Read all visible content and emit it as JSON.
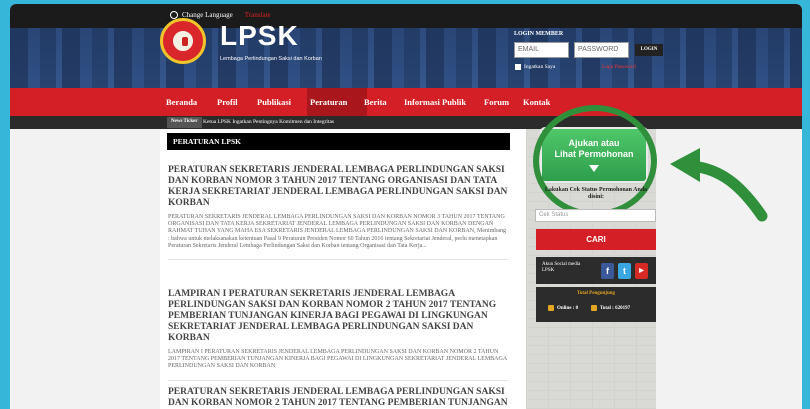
{
  "topbar": {
    "change_language": "Change Language",
    "translate": "Translate"
  },
  "header": {
    "logo_title": "LPSK",
    "logo_subtitle": "Lembaga Perlindungan Saksi dan Korban"
  },
  "login": {
    "label": "LOGIN MEMBER",
    "email_placeholder": "EMAIL",
    "password_placeholder": "PASSWORD",
    "button": "LOGIN",
    "remember": "Ingatkan Saya",
    "forgot": "Lupa Password"
  },
  "nav": {
    "items": [
      "Beranda",
      "Profil",
      "Publikasi",
      "Peraturan",
      "Berita",
      "Informasi Publik",
      "Forum",
      "Kontak"
    ],
    "active": "Peraturan"
  },
  "ticker": {
    "tag": "News Ticker",
    "text": "Ketua LPSK Ingatkan Pentingnya Komitmen dan Integritas"
  },
  "content": {
    "section_title": "PERATURAN LPSK",
    "articles": [
      {
        "title": "PERATURAN SEKRETARIS JENDERAL LEMBAGA PERLINDUNGAN SAKSI DAN KORBAN NOMOR 3 TAHUN 2017 TENTANG ORGANISASI DAN TATA KERJA SEKRETARIAT JENDERAL LEMBAGA PERLINDUNGAN SAKSI DAN KORBAN",
        "excerpt": "PERATURAN SEKRETARIS JENDERAL LEMBAGA PERLINDUNGAN SAKSI DAN KORBAN NOMOR 3 TAHUN 2017   TENTANG   ORGANISASI DAN TATA KERJA SEKRETARIAT JENDERAL LEMBAGA PERLINDUNGAN SAKSI DAN KORBAN   DENGAN RAHMAT TUHAN YANG MAHA ESA   SEKRETARIS JENDERAL LEMBAGA PERLINDUNGAN SAKSI DAN KORBAN,   Menimbang : bahwa untuk melaksanakan ketentuan Pasal 9 Peraturan Presiden Nomor 60 Tahun 2016 tentang Sekretariat Jenderal, perlu menetapkan Peraturan Sekretaris Jenderal Lembaga Perlindungan Saksi dan Korban tentang Organisasi dan Tata Kerja..."
      },
      {
        "title": "LAMPIRAN I PERATURAN SEKRETARIS JENDERAL LEMBAGA PERLINDUNGAN SAKSI DAN KORBAN NOMOR 2 TAHUN 2017 TENTANG PEMBERIAN TUNJANGAN KINERJA BAGI PEGAWAI DI LINGKUNGAN SEKRETARIAT JENDERAL LEMBAGA PERLINDUNGAN SAKSI DAN KORBAN",
        "excerpt": "LAMPIRAN I   PERATURAN SEKRETARIS JENDERAL LEMBAGA PERLINDUNGAN SAKSI DAN KORBAN NOMOR 2 TAHUN 2017   TENTANG   PEMBERIAN TUNJANGAN KINERJA BAGI PEGAWAI DI LINGKUNGAN SEKRETARIAT JENDERAL LEMBAGA PERLINDUNGAN SAKSI DAN KORBAN"
      },
      {
        "title": "PERATURAN SEKRETARIS JENDERAL LEMBAGA PERLINDUNGAN SAKSI DAN KORBAN NOMOR 2 TAHUN 2017 TENTANG PEMBERIAN TUNJANGAN KINERJA BAGI PEGAWAI DI LINGKUNGAN SEKRETARIAT JENDERAL",
        "excerpt": ""
      }
    ]
  },
  "sidebar": {
    "ajukan_line1": "Ajukan atau",
    "ajukan_line2": "Lihat Permohonan",
    "status_label": "Lakukan Cek Status Permohonan Anda disini:",
    "status_placeholder": "Cek Status",
    "cari": "CARI",
    "social_label": "Akun Social media LPSK",
    "social_icons": [
      "facebook-icon",
      "twitter-icon",
      "youtube-icon"
    ],
    "visitors_title": "Total Pengunjung",
    "online": "Online : 0",
    "total": "Total : 620197"
  },
  "colors": {
    "nav_red": "#d51f26",
    "highlight_green": "#2f8f3b",
    "page_bg": "#36b6d8"
  }
}
